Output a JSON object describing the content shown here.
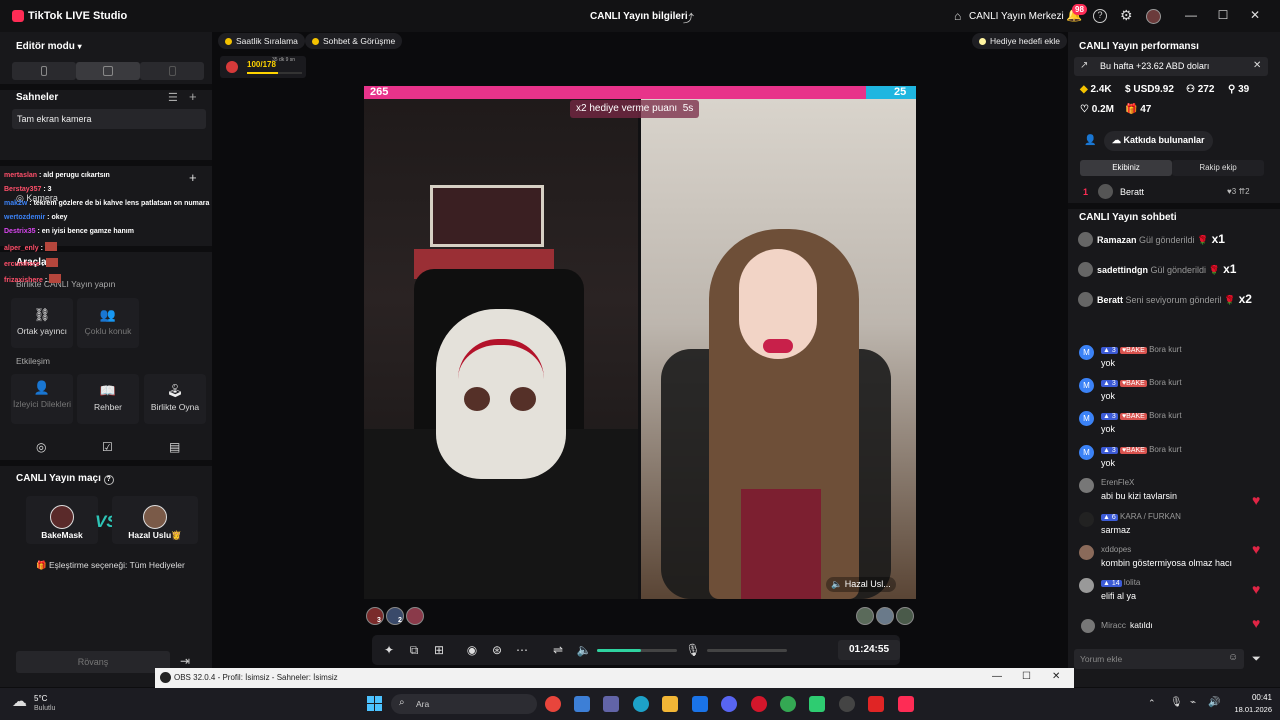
{
  "titlebar": {
    "app_title": "TikTok LIVE Studio",
    "center_title": "CANLI Yayın bilgileri",
    "live_center": "CANLI Yayın Merkezi",
    "notif_count": "98"
  },
  "left": {
    "editor_mode": "Editör modu",
    "scenes_title": "Sahneler",
    "scene_item": "Tam ekran kamera",
    "camera_label": "Kamera",
    "tools_title": "Araçlar",
    "collab_title": "Birlikte CANLI Yayın yapın",
    "cohost": "Ortak yayıncı",
    "multi_guest": "Çoklu konuk",
    "interaction_title": "Etkileşim",
    "viewer_wishes": "İzleyici Dilekleri",
    "guide": "Rehber",
    "play_together": "Birlikte Oyna",
    "match_title": "CANLI Yayın maçı",
    "player1": "BakeMask",
    "player2": "Hazal Uslu👸",
    "vs": "VS",
    "match_option": "🎁 Eşleştirme seçeneği: Tüm Hediyeler",
    "rematch": "Rövanş"
  },
  "overlay_chat": [
    {
      "name": "mertaslan",
      "text": "ald perugu cıkartsın",
      "color": "#ff4f6a"
    },
    {
      "name": "Berstay357",
      "text": "3",
      "color": "#ff4f6a"
    },
    {
      "name": "mak2w",
      "text": "tekrem gözlere de bi kahve lens patlatsan on numara",
      "color": "#3b82f6"
    },
    {
      "name": "wertozdemir",
      "text": "okey",
      "color": "#3b82f6"
    },
    {
      "name": "Destrix35",
      "text": "en iyisi bence gamze hanım",
      "color": "#d946ef"
    },
    {
      "name": "alper_enly",
      "text": "",
      "color": "#ff4f6a"
    },
    {
      "name": "ercumhere",
      "text": "",
      "color": "#ff4f6a"
    },
    {
      "name": "frizaxishere",
      "text": "",
      "color": "#ff4f6a"
    }
  ],
  "stage": {
    "chip_hourly": "Saatlik Sıralama",
    "chip_chat": "Sohbet & Görüşme",
    "gift_goal": "Hediye hedefi ekle",
    "goal_progress": "100/178",
    "goal_fraction": 0.56,
    "goal_timer": "35 dk 9 sn",
    "score_left": "265",
    "score_right": "25",
    "multiplier_text": "x2 hediye verme puanı",
    "multiplier_time": "5s",
    "guest_label": "Hazal Usl...",
    "gifter_counts_left": [
      "3",
      "2",
      ""
    ],
    "volume_fraction": 0.55,
    "timer": "01:24:55"
  },
  "right": {
    "perf_title": "CANLI Yayın performansı",
    "weekly": "Bu hafta +23.62 ABD doları",
    "stat_diamonds": "2.4K",
    "stat_usd": "USD9.92",
    "stat_viewers": "272",
    "stat_likes_people": "39",
    "stat_likes": "0.2M",
    "stat_gifts": "47",
    "contributors": "Katkıda bulunanlar",
    "tab_team": "Ekibiniz",
    "tab_rival": "Rakip ekip",
    "rank1_num": "1",
    "rank1_name": "Beratt",
    "rank1_stat1": "3",
    "rank1_stat2": "2",
    "chat_title": "CANLI Yayın sohbeti",
    "gift_msgs": [
      {
        "name": "Ramazan",
        "text": "Gül gönderildi",
        "count": "x1"
      },
      {
        "name": "sadettindgn",
        "text": "Gül gönderildi",
        "count": "x1"
      },
      {
        "name": "Beratt",
        "text": "Seni seviyorum gönderil",
        "count": "x2"
      }
    ],
    "chat": [
      {
        "user": "Bora kurt",
        "lvl": "3",
        "fan": "BAKE",
        "text": "yok"
      },
      {
        "user": "Bora kurt",
        "lvl": "3",
        "fan": "BAKE",
        "text": "yok"
      },
      {
        "user": "Bora kurt",
        "lvl": "3",
        "fan": "BAKE",
        "text": "yok"
      },
      {
        "user": "Bora kurt",
        "lvl": "3",
        "fan": "BAKE",
        "text": "yok"
      },
      {
        "user": "ErenFleX",
        "lvl": "",
        "fan": "",
        "text": "abi bu kizi tavlarsin"
      },
      {
        "user": "KARA / FURKAN",
        "lvl": "6",
        "fan": "",
        "text": "sarmaz"
      },
      {
        "user": "xddopes",
        "lvl": "",
        "fan": "",
        "text": "kombin göstermiyosa olmaz hacı"
      },
      {
        "user": "lolita",
        "lvl": "14",
        "fan": "",
        "text": "elifi al ya"
      }
    ],
    "join_name": "Miracc",
    "join_text": "katıldı",
    "comment_placeholder": "Yorum ekle"
  },
  "obs": {
    "title": "OBS 32.0.4 - Profil: İsimsiz - Sahneler: İsimsiz"
  },
  "taskbar": {
    "temp": "5°C",
    "weather": "Bulutlu",
    "search": "Ara",
    "time": "00:41",
    "date": "18.01.2026"
  }
}
